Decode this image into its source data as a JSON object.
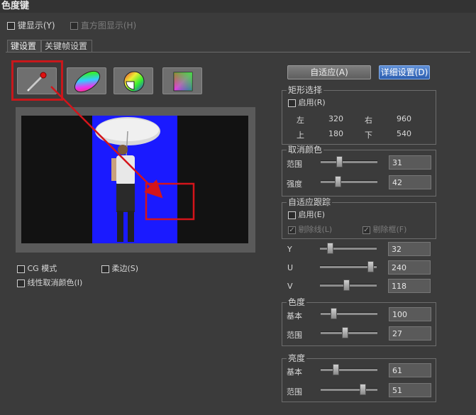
{
  "title": "色度键",
  "top_options": {
    "key_display": "键显示(Y)",
    "histogram_display": "直方图显示(H)"
  },
  "tabs": [
    "键设置",
    "关键帧设置"
  ],
  "tools": [
    "dropper-icon",
    "color-wheel-ellipse-icon",
    "color-wheel-sector-icon",
    "color-square-icon"
  ],
  "buttons": {
    "adaptive": "自适应(A)",
    "detail_settings": "详细设置(D)"
  },
  "rect_select": {
    "title": "矩形选择",
    "enable": "启用(R)",
    "left_label": "左",
    "left_value": "320",
    "right_label": "右",
    "right_value": "960",
    "top_label": "上",
    "top_value": "180",
    "bottom_label": "下",
    "bottom_value": "540"
  },
  "despill": {
    "title": "取消颜色",
    "range_label": "范围",
    "range_value": "31",
    "range_level": 0.31,
    "strength_label": "强度",
    "strength_value": "42",
    "strength_level": 0.28
  },
  "adaptive_tracking": {
    "title": "自适应跟踪",
    "enable": "启用(E)",
    "remove_line": "剔除线(L)",
    "remove_frame": "剔除框(F)"
  },
  "yuv": {
    "y_label": "Y",
    "y_value": "32",
    "y_level": 0.14,
    "u_label": "U",
    "u_value": "240",
    "u_level": 0.94,
    "v_label": "V",
    "v_value": "118",
    "v_level": 0.46
  },
  "chroma": {
    "title": "色度",
    "base_label": "基本",
    "base_value": "100",
    "base_level": 0.2,
    "range_label": "范围",
    "range_value": "27",
    "range_level": 0.42
  },
  "luma": {
    "title": "亮度",
    "base_label": "基本",
    "base_value": "61",
    "base_level": 0.24,
    "range_label": "范围",
    "range_value": "51",
    "range_level": 0.77
  },
  "bottom_options": {
    "cg_mode": "CG 模式",
    "soft_edge": "柔边(S)",
    "linear_despill": "线性取消颜色(I)"
  },
  "colors": {
    "blue_screen": "#1a1aff",
    "annotation_red": "#d4141a",
    "highlight_button": "#2d5fb0"
  }
}
